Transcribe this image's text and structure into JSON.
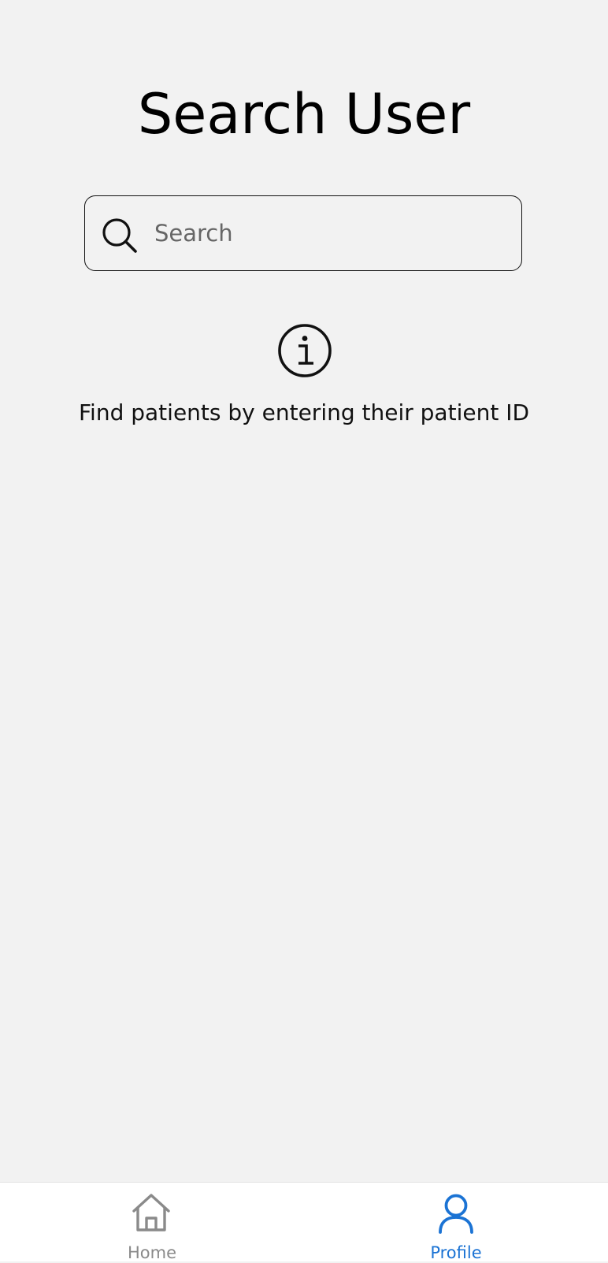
{
  "header": {
    "title": "Search User"
  },
  "search": {
    "placeholder": "Search",
    "value": "",
    "icon": "search-icon"
  },
  "empty_state": {
    "icon": "info-icon",
    "message": "Find patients by entering their patient ID"
  },
  "tab_bar": {
    "tabs": [
      {
        "label": "Home",
        "icon": "home-icon",
        "active": false,
        "color": "#8a8a8a"
      },
      {
        "label": "Profile",
        "icon": "user-icon",
        "active": true,
        "color": "#1b73d4"
      }
    ]
  },
  "colors": {
    "background": "#f2f2f2",
    "accent": "#1b73d4",
    "inactive": "#8a8a8a",
    "tab_bar_background": "#ffffff"
  }
}
